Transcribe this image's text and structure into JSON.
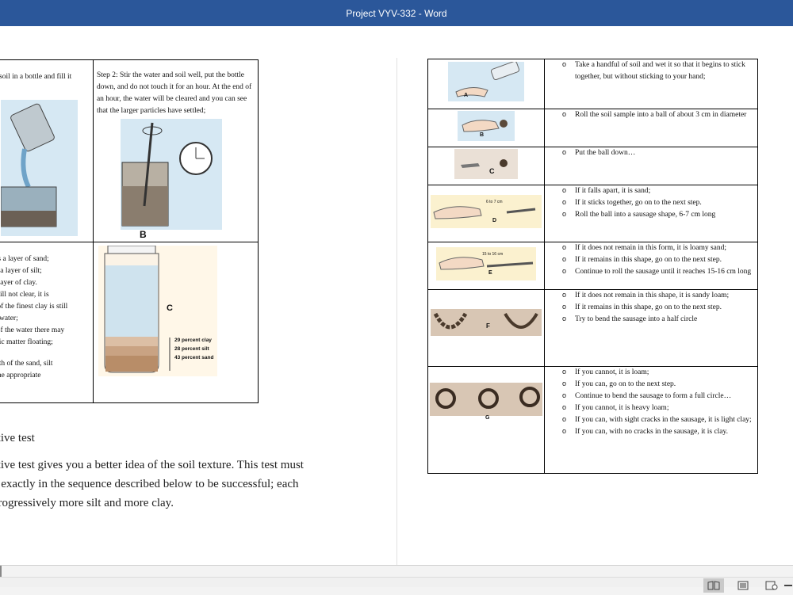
{
  "window": {
    "title": "Project VYV-332 - Word"
  },
  "left_page": {
    "table": {
      "cell_1": "soil in a bottle and fill it",
      "cell_2": "Step 2: Stir the water and soil well, put the bottle down, and do not touch it for an hour. At the end of an hour, the water will be cleared and you can see that the larger particles have settled;",
      "figure_b_label": "B",
      "cell_3_lines": [
        "m is a layer of sand;",
        "e is a layer of silt;",
        "s a layer of clay.",
        "is still not clear, it is",
        "ne of the finest clay is still",
        " the water;",
        "ce of the water there may",
        "ganic matter floating;",
        "",
        " depth of the sand, silt",
        "te the appropriate"
      ],
      "figure_c_label": "C",
      "jar_legend": [
        "29 percent clay",
        "28 percent silt",
        "43 percent sand"
      ]
    },
    "heading": "ative test",
    "paragraph_lines": [
      "ative test gives you a better idea of the soil texture. This test must",
      "d exactly in the sequence described below to be successful; each",
      " progressively more silt and more clay."
    ]
  },
  "right_page": {
    "rows": [
      {
        "fig_label": "A",
        "items": [
          "Take a handful of soil and wet it so that it begins to stick together, but without sticking to your hand;"
        ]
      },
      {
        "fig_label": "B",
        "items": [
          "Roll the soil sample into a ball of about 3 cm in diameter"
        ]
      },
      {
        "fig_label": "C",
        "items": [
          "Put the ball down…"
        ]
      },
      {
        "fig_label": "D",
        "fig_note": "6 to 7 cm",
        "items": [
          "If it falls apart, it is sand;",
          "If it sticks together, go on to the next step.",
          "Roll the ball into a sausage shape, 6-7 cm long"
        ]
      },
      {
        "fig_label": "E",
        "fig_note": "15 to 16 cm",
        "items": [
          "If it does not remain in this form, it is loamy sand;",
          "If it remains in this shape, go on to the next step.",
          "Continue to roll the sausage until it reaches 15-16 cm long"
        ]
      },
      {
        "fig_label": "F",
        "items": [
          "If it does not remain in this shape, it is sandy loam;",
          "If it remains in this shape, go on to the next step.",
          "Try to bend the sausage into a half circle"
        ]
      },
      {
        "fig_label": "G",
        "items": [
          "If you cannot, it is loam;",
          "If you can, go on to the next step.",
          "Continue to bend the sausage to form a full circle…",
          "If you cannot, it is heavy loam;",
          "If you can, with sight cracks in the sausage, it is light clay;",
          "If you can, with no cracks in the sausage, it is clay."
        ]
      }
    ]
  },
  "status_bar": {
    "views": [
      {
        "name": "read-mode-icon",
        "active": true
      },
      {
        "name": "print-layout-icon",
        "active": false
      },
      {
        "name": "web-layout-icon",
        "active": false
      },
      {
        "name": "zoom-out-icon",
        "active": false
      }
    ]
  },
  "colors": {
    "title_bar": "#2b579a",
    "figure_bg": "#d6e8f3",
    "soil_bg": "#d8c6b4"
  }
}
